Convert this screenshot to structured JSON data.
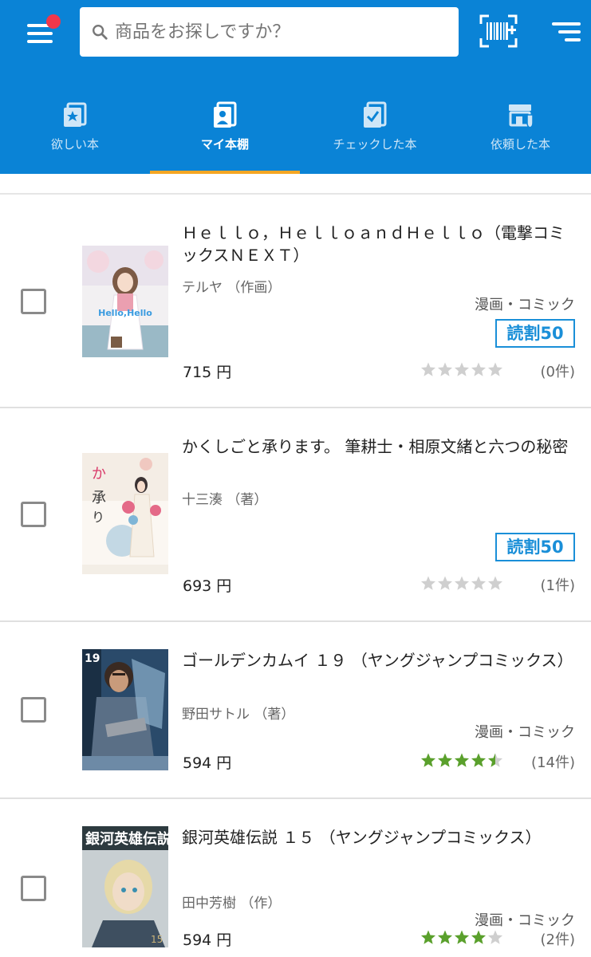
{
  "header": {
    "search_placeholder": "商品をお探しですか？",
    "colors": {
      "brand": "#0a83d6",
      "tab_indicator": "#f5a623",
      "notification": "#f0374a"
    }
  },
  "tabs": [
    {
      "label": "欲しい本",
      "icon": "wish-book-icon",
      "active": false
    },
    {
      "label": "マイ本棚",
      "icon": "bookshelf-icon",
      "active": true
    },
    {
      "label": "チェックした本",
      "icon": "checked-book-icon",
      "active": false
    },
    {
      "label": "依頼した本",
      "icon": "requested-book-icon",
      "active": false
    }
  ],
  "items": [
    {
      "title": "Ｈｅｌｌｏ，ＨｅｌｌｏａｎｄＨｅｌｌｏ（電撃コミックスＮＥＸＴ）",
      "author": "テルヤ （作画）",
      "category": "漫画・コミック",
      "badge": "読割50",
      "price": "715 円",
      "rating": 0,
      "review_count": "(0件)"
    },
    {
      "title": "かくしごと承ります。 筆耕士・相原文緒と六つの秘密",
      "author": "十三湊 （著）",
      "category": "",
      "badge": "読割50",
      "price": "693 円",
      "rating": 0,
      "review_count": "(1件)"
    },
    {
      "title": "ゴールデンカムイ １９ （ヤングジャンプコミックス）",
      "author": "野田サトル （著）",
      "category": "漫画・コミック",
      "badge": "",
      "price": "594 円",
      "rating": 4.5,
      "review_count": "(14件)"
    },
    {
      "title": "銀河英雄伝説 １５ （ヤングジャンプコミックス）",
      "author": "田中芳樹 （作）",
      "category": "漫画・コミック",
      "badge": "",
      "price": "594 円",
      "rating": 4,
      "review_count": "(2件)"
    }
  ]
}
